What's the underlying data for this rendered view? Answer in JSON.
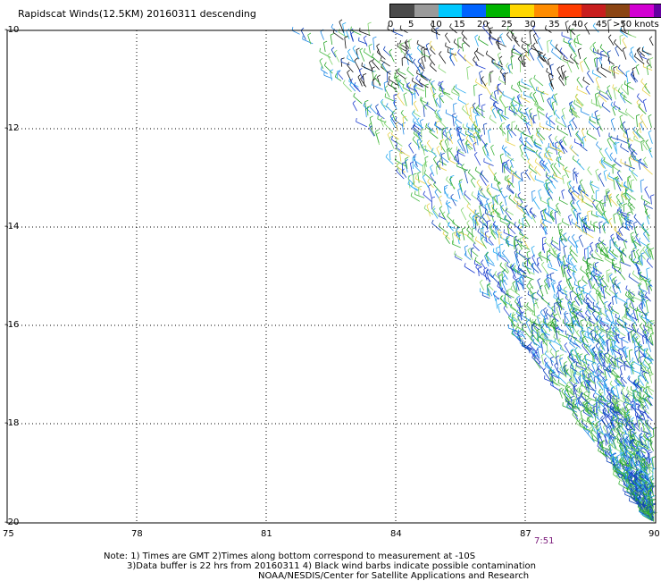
{
  "header": {
    "title": "Rapidscat Winds(12.5KM) 20160311 descending"
  },
  "legend": {
    "labels": [
      "0",
      "5",
      "10",
      "15",
      "20",
      "25",
      "30",
      "35",
      "40",
      "45",
      ">50 knots"
    ],
    "colors": [
      "#4a4a4a",
      "#9a9a9a",
      "#00c8ff",
      "#0064ff",
      "#00b400",
      "#ffd700",
      "#ff8c00",
      "#ff3c00",
      "#c81e1e",
      "#8b4513",
      "#d200d2",
      "#6400a0"
    ]
  },
  "map": {
    "lat_labels": [
      "-10",
      "-12",
      "-14",
      "-16",
      "-18",
      "-20"
    ],
    "lon_labels": [
      "75",
      "78",
      "81",
      "84",
      "87",
      "90"
    ],
    "timestamp": "7:51"
  },
  "notes": {
    "line1": "Note: 1) Times are GMT 2)Times along bottom correspond to measurement at -10S",
    "line2": "3)Data buffer is 22 hrs from 20160311 4) Black wind barbs indicate possible contamination",
    "line3": "NOAA/NESDIS/Center for Satellite Applications and Research"
  }
}
